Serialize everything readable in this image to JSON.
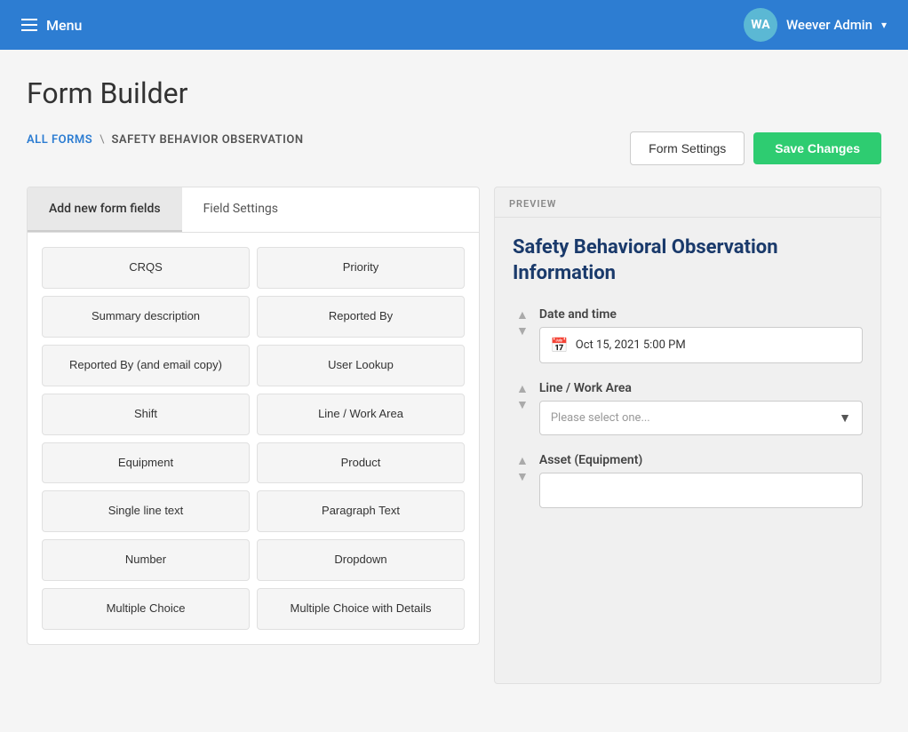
{
  "header": {
    "menu_label": "Menu",
    "avatar_initials": "WA",
    "user_name": "Weever Admin",
    "dropdown_arrow": "▾"
  },
  "page": {
    "title": "Form Builder",
    "breadcrumb_link": "ALL FORMS",
    "breadcrumb_sep": "\\",
    "breadcrumb_current": "SAFETY BEHAVIOR OBSERVATION",
    "btn_form_settings": "Form Settings",
    "btn_save_changes": "Save Changes"
  },
  "left_panel": {
    "tabs": [
      {
        "label": "Add new form fields",
        "active": true
      },
      {
        "label": "Field Settings",
        "active": false
      }
    ],
    "fields": [
      {
        "label": "CRQS"
      },
      {
        "label": "Priority"
      },
      {
        "label": "Summary description"
      },
      {
        "label": "Reported By"
      },
      {
        "label": "Reported By (and email copy)"
      },
      {
        "label": "User Lookup"
      },
      {
        "label": "Shift"
      },
      {
        "label": "Line / Work Area"
      },
      {
        "label": "Equipment"
      },
      {
        "label": "Product"
      },
      {
        "label": "Single line text"
      },
      {
        "label": "Paragraph Text"
      },
      {
        "label": "Number"
      },
      {
        "label": "Dropdown"
      },
      {
        "label": "Multiple Choice"
      },
      {
        "label": "Multiple Choice with Details"
      }
    ]
  },
  "right_panel": {
    "preview_label": "PREVIEW",
    "form_title_line1": "Safety Behavioral Observation",
    "form_title_line2": "Information",
    "fields": [
      {
        "label": "Date and time",
        "type": "datetime",
        "value": "Oct 15, 2021 5:00 PM"
      },
      {
        "label": "Line / Work Area",
        "type": "select",
        "placeholder": "Please select one..."
      },
      {
        "label": "Asset (Equipment)",
        "type": "text",
        "value": ""
      }
    ]
  }
}
